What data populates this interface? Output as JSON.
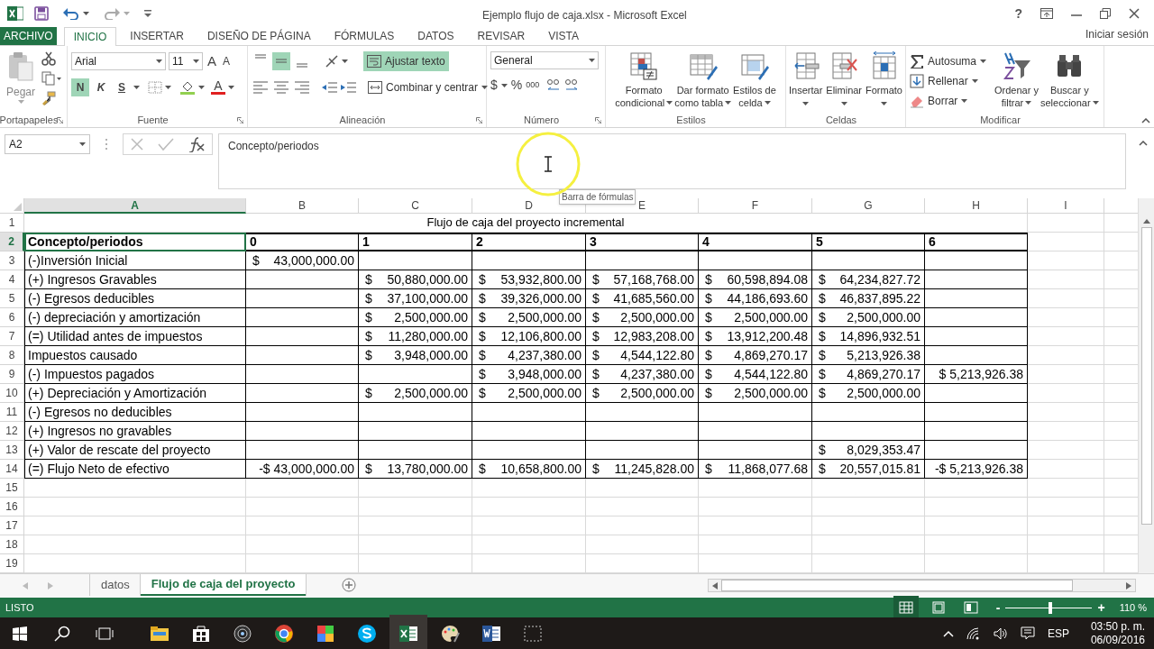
{
  "window": {
    "title": "Ejemplo flujo de caja.xlsx - Microsoft Excel",
    "help": "?"
  },
  "ribbon_tabs": [
    {
      "label": "ARCHIVO",
      "kind": "file",
      "selected": false
    },
    {
      "label": "INICIO",
      "kind": "tab",
      "selected": true
    },
    {
      "label": "INSERTAR",
      "kind": "tab",
      "selected": false
    },
    {
      "label": "DISEÑO DE PÁGINA",
      "kind": "tab",
      "selected": false
    },
    {
      "label": "FÓRMULAS",
      "kind": "tab",
      "selected": false
    },
    {
      "label": "DATOS",
      "kind": "tab",
      "selected": false
    },
    {
      "label": "REVISAR",
      "kind": "tab",
      "selected": false
    },
    {
      "label": "VISTA",
      "kind": "tab",
      "selected": false
    }
  ],
  "account": "Iniciar sesión",
  "ribbon": {
    "clipboard": {
      "label": "Portapapeles",
      "paste": "Pegar"
    },
    "font": {
      "label": "Fuente",
      "name": "Arial",
      "size": "11",
      "grow": "A",
      "shrink": "A",
      "styles": [
        {
          "label": "N",
          "kind": "bold",
          "on": true
        },
        {
          "label": "K",
          "kind": "italic",
          "on": false
        },
        {
          "label": "S",
          "kind": "underline",
          "on": false
        }
      ],
      "font_color": "A"
    },
    "alignment": {
      "label": "Alineación",
      "vertical": [
        {
          "selected": false
        },
        {
          "selected": true
        },
        {
          "selected": false
        }
      ],
      "wrap_text": {
        "label": "Ajustar texto",
        "on": true
      },
      "merge": "Combinar y centrar"
    },
    "number": {
      "label": "Número",
      "format": "General",
      "buttons": [
        "$",
        "%",
        "000"
      ]
    },
    "styles": {
      "label": "Estilos",
      "buttons": [
        {
          "kind": "conditional",
          "lines": [
            "Formato",
            "condicional"
          ]
        },
        {
          "kind": "table",
          "lines": [
            "Dar formato",
            "como tabla"
          ]
        },
        {
          "kind": "cellstyle",
          "lines": [
            "Estilos de",
            "celda"
          ]
        }
      ]
    },
    "cells": {
      "label": "Celdas",
      "buttons": [
        {
          "kind": "insert",
          "lines": [
            "Insertar"
          ]
        },
        {
          "kind": "delete",
          "lines": [
            "Eliminar"
          ]
        },
        {
          "kind": "format",
          "lines": [
            "Formato"
          ]
        }
      ]
    },
    "editing": {
      "label": "Modificar",
      "items": [
        {
          "kind": "sum",
          "label": "Autosuma"
        },
        {
          "kind": "fill",
          "label": "Rellenar"
        },
        {
          "kind": "clear",
          "label": "Borrar"
        }
      ],
      "buttons": [
        {
          "kind": "sort",
          "lines": [
            "Ordenar y",
            "filtrar"
          ]
        },
        {
          "kind": "find",
          "lines": [
            "Buscar y",
            "seleccionar"
          ]
        }
      ]
    }
  },
  "formula_bar": {
    "name_box": "A2",
    "value": "Concepto/periodos",
    "tooltip": "Barra de fórmulas"
  },
  "sheet": {
    "columns": [
      {
        "label": "A",
        "selected": true
      },
      {
        "label": "B",
        "selected": false
      },
      {
        "label": "C",
        "selected": false
      },
      {
        "label": "D",
        "selected": false
      },
      {
        "label": "E",
        "selected": false
      },
      {
        "label": "F",
        "selected": false
      },
      {
        "label": "G",
        "selected": false
      },
      {
        "label": "H",
        "selected": false
      },
      {
        "label": "I",
        "selected": false
      }
    ],
    "rows": [
      {
        "number": "1",
        "kind": "title",
        "selected": false,
        "title": "Flujo de caja del proyecto incremental"
      },
      {
        "number": "2",
        "kind": "header",
        "selected": true,
        "cells": [
          "Concepto/periodos",
          "0",
          "1",
          "2",
          "3",
          "4",
          "5",
          "6"
        ]
      },
      {
        "number": "3",
        "kind": "data",
        "selected": false,
        "cells": [
          "(-)Inversión Inicial",
          {
            "currency": "$",
            "amount": "43,000,000.00"
          },
          null,
          null,
          null,
          null,
          null,
          null
        ]
      },
      {
        "number": "4",
        "kind": "data",
        "selected": false,
        "cells": [
          "(+) Ingresos Gravables",
          null,
          {
            "currency": "$",
            "amount": "50,880,000.00"
          },
          {
            "currency": "$",
            "amount": "53,932,800.00"
          },
          {
            "currency": "$",
            "amount": "57,168,768.00"
          },
          {
            "currency": "$",
            "amount": "60,598,894.08"
          },
          {
            "currency": "$",
            "amount": "64,234,827.72"
          },
          null
        ]
      },
      {
        "number": "5",
        "kind": "data",
        "selected": false,
        "cells": [
          "(-) Egresos deducibles",
          null,
          {
            "currency": "$",
            "amount": "37,100,000.00"
          },
          {
            "currency": "$",
            "amount": "39,326,000.00"
          },
          {
            "currency": "$",
            "amount": "41,685,560.00"
          },
          {
            "currency": "$",
            "amount": "44,186,693.60"
          },
          {
            "currency": "$",
            "amount": "46,837,895.22"
          },
          null
        ]
      },
      {
        "number": "6",
        "kind": "data",
        "selected": false,
        "cells": [
          "(-) depreciación y amortización",
          null,
          {
            "currency": "$",
            "amount": "2,500,000.00"
          },
          {
            "currency": "$",
            "amount": "2,500,000.00"
          },
          {
            "currency": "$",
            "amount": "2,500,000.00"
          },
          {
            "currency": "$",
            "amount": "2,500,000.00"
          },
          {
            "currency": "$",
            "amount": "2,500,000.00"
          },
          null
        ]
      },
      {
        "number": "7",
        "kind": "data",
        "selected": false,
        "cells": [
          "(=) Utilidad antes de impuestos",
          null,
          {
            "currency": "$",
            "amount": "11,280,000.00"
          },
          {
            "currency": "$",
            "amount": "12,106,800.00"
          },
          {
            "currency": "$",
            "amount": "12,983,208.00"
          },
          {
            "currency": "$",
            "amount": "13,912,200.48"
          },
          {
            "currency": "$",
            "amount": "14,896,932.51"
          },
          null
        ]
      },
      {
        "number": "8",
        "kind": "data",
        "selected": false,
        "cells": [
          "Impuestos causado",
          null,
          {
            "currency": "$",
            "amount": "3,948,000.00"
          },
          {
            "currency": "$",
            "amount": "4,237,380.00"
          },
          {
            "currency": "$",
            "amount": "4,544,122.80"
          },
          {
            "currency": "$",
            "amount": "4,869,270.17"
          },
          {
            "currency": "$",
            "amount": "5,213,926.38"
          },
          null
        ]
      },
      {
        "number": "9",
        "kind": "data",
        "selected": false,
        "cells": [
          "(-) Impuestos pagados",
          null,
          null,
          {
            "currency": "$",
            "amount": "3,948,000.00"
          },
          {
            "currency": "$",
            "amount": "4,237,380.00"
          },
          {
            "currency": "$",
            "amount": "4,544,122.80"
          },
          {
            "currency": "$",
            "amount": "4,869,270.17"
          },
          "$ 5,213,926.38"
        ]
      },
      {
        "number": "10",
        "kind": "data",
        "selected": false,
        "cells": [
          "(+) Depreciación y Amortización",
          null,
          {
            "currency": "$",
            "amount": "2,500,000.00"
          },
          {
            "currency": "$",
            "amount": "2,500,000.00"
          },
          {
            "currency": "$",
            "amount": "2,500,000.00"
          },
          {
            "currency": "$",
            "amount": "2,500,000.00"
          },
          {
            "currency": "$",
            "amount": "2,500,000.00"
          },
          null
        ]
      },
      {
        "number": "11",
        "kind": "data",
        "selected": false,
        "cells": [
          "(-) Egresos no deducibles",
          null,
          null,
          null,
          null,
          null,
          null,
          null
        ]
      },
      {
        "number": "12",
        "kind": "data",
        "selected": false,
        "cells": [
          "(+) Ingresos no gravables",
          null,
          null,
          null,
          null,
          null,
          null,
          null
        ]
      },
      {
        "number": "13",
        "kind": "data",
        "selected": false,
        "cells": [
          "(+) Valor de rescate del proyecto",
          null,
          null,
          null,
          null,
          null,
          {
            "currency": "$",
            "amount": "8,029,353.47"
          },
          null
        ]
      },
      {
        "number": "14",
        "kind": "data",
        "selected": false,
        "cells": [
          "(=) Flujo Neto de efectivo",
          "-$ 43,000,000.00",
          {
            "currency": "$",
            "amount": "13,780,000.00"
          },
          {
            "currency": "$",
            "amount": "10,658,800.00"
          },
          {
            "currency": "$",
            "amount": "11,245,828.00"
          },
          {
            "currency": "$",
            "amount": "11,868,077.68"
          },
          {
            "currency": "$",
            "amount": "20,557,015.81"
          },
          "-$ 5,213,926.38"
        ]
      },
      {
        "number": "15",
        "kind": "empty",
        "selected": false
      },
      {
        "number": "16",
        "kind": "empty",
        "selected": false
      },
      {
        "number": "17",
        "kind": "empty",
        "selected": false
      },
      {
        "number": "18",
        "kind": "empty",
        "selected": false
      },
      {
        "number": "19",
        "kind": "empty",
        "selected": false
      }
    ]
  },
  "sheet_tabs": [
    {
      "label": "datos",
      "selected": false
    },
    {
      "label": "Flujo de caja del proyecto",
      "selected": true
    }
  ],
  "status_bar": {
    "mode": "LISTO",
    "views": [
      {
        "selected": true
      },
      {
        "selected": false
      },
      {
        "selected": false
      }
    ],
    "zoom_slider": {
      "minus": "-",
      "plus": "+",
      "level": 0.52
    },
    "zoom": "110 %"
  },
  "taskbar": {
    "language": "ESP",
    "time": "03:50 p. m.",
    "date": "06/09/2016"
  }
}
